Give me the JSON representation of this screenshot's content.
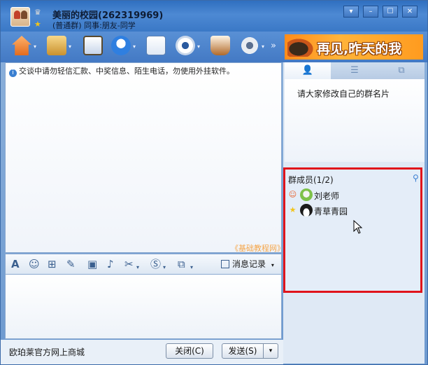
{
  "window": {
    "group_name": "美丽的校园(262319969)",
    "group_subtitle": "(普通群) 同事:朋友-同学",
    "crown_glyph": "♛",
    "star_glyph": "★"
  },
  "window_controls": {
    "dropdown": "▾",
    "minimize": "–",
    "maximize": "☐",
    "close": "✕"
  },
  "toolbar": {
    "more": "»",
    "arrow": "▾",
    "banner_text": "再见,昨天的我"
  },
  "chat": {
    "notice": "交谈中请勿轻信汇款、中奖信息、陌生电话，勿使用外挂软件。",
    "watermark": "《基础教程网》"
  },
  "format_bar": {
    "icons": [
      "A",
      "☺",
      "⊞",
      "✎",
      "▣",
      "♪",
      "✂",
      "Ⓢ",
      "⧉"
    ],
    "message_record_label": "消息记录",
    "arrow": "▾"
  },
  "bottom": {
    "ad_text": "欧珀莱官方网上商城",
    "close_label": "关闭(C)",
    "send_label": "发送(S)",
    "send_arrow": "▾"
  },
  "side_panel": {
    "tabs": [
      "👤",
      "☰",
      "⧉"
    ],
    "announcement": "请大家修改自己的群名片",
    "members_header": "群成员(1/2)",
    "search_glyph": "⚲",
    "members": [
      {
        "name": "刘老师",
        "badge": "☺",
        "badge_color": "#e85f2a"
      },
      {
        "name": "青草青园",
        "badge": "★",
        "badge_color": "#f2c419"
      }
    ]
  },
  "colors": {
    "title_bar": "#3a78c6",
    "highlight_border": "#e0141b",
    "banner": "#ff9b1f"
  }
}
